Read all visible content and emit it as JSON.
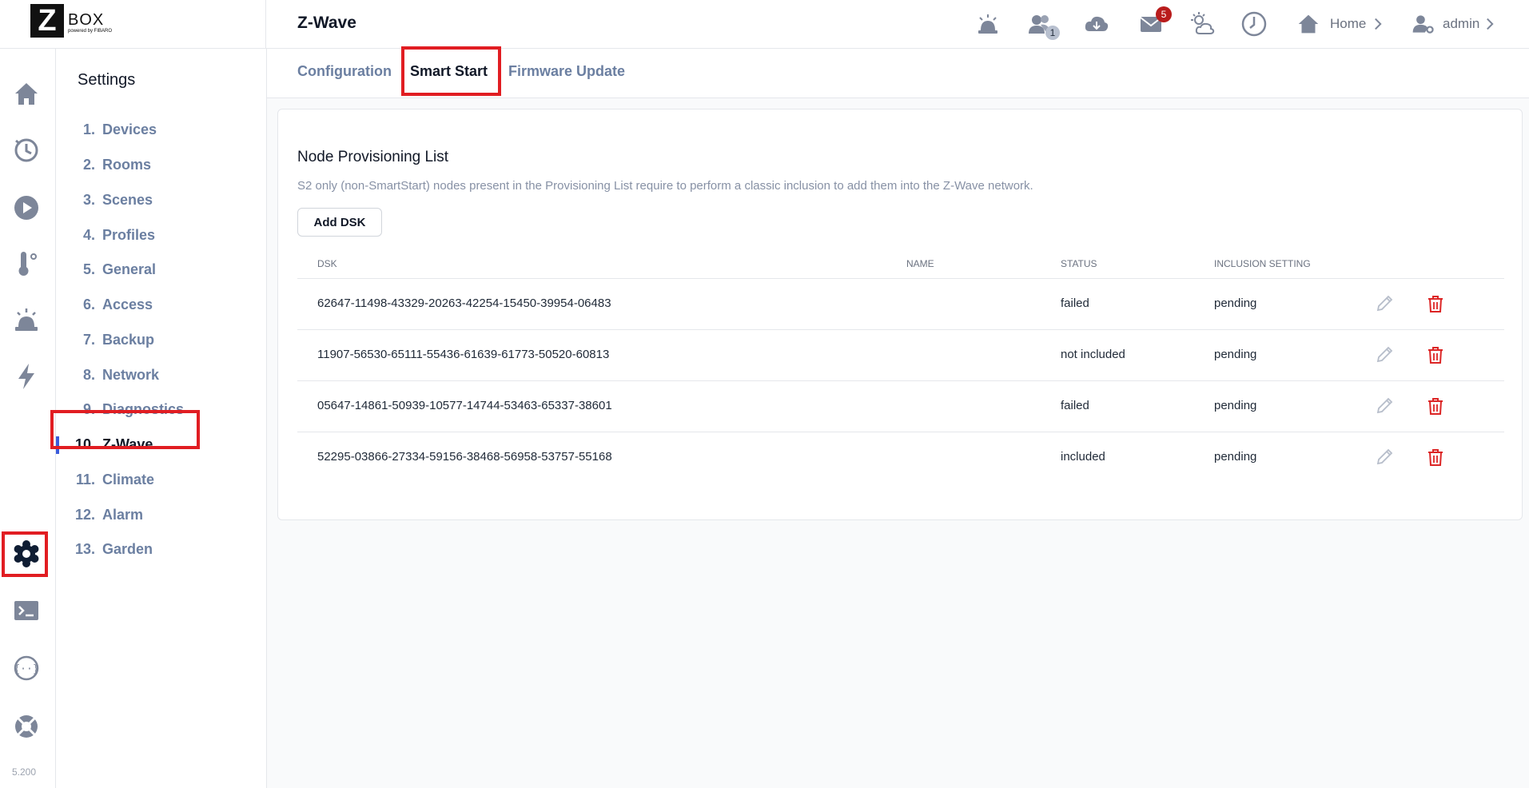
{
  "brand": {
    "logo_letter": "Z",
    "logo_word": "BOX",
    "logo_sub": "powered by FIBARO"
  },
  "header": {
    "title": "Z-Wave",
    "users_badge": "1",
    "messages_badge": "5",
    "home_label": "Home",
    "user_label": "admin"
  },
  "rail": {
    "version": "5.200"
  },
  "settings_menu": {
    "title": "Settings",
    "items": [
      {
        "num": "1.",
        "label": "Devices"
      },
      {
        "num": "2.",
        "label": "Rooms"
      },
      {
        "num": "3.",
        "label": "Scenes"
      },
      {
        "num": "4.",
        "label": "Profiles"
      },
      {
        "num": "5.",
        "label": "General"
      },
      {
        "num": "6.",
        "label": "Access"
      },
      {
        "num": "7.",
        "label": "Backup"
      },
      {
        "num": "8.",
        "label": "Network"
      },
      {
        "num": "9.",
        "label": "Diagnostics"
      },
      {
        "num": "10.",
        "label": "Z-Wave"
      },
      {
        "num": "11.",
        "label": "Climate"
      },
      {
        "num": "12.",
        "label": "Alarm"
      },
      {
        "num": "13.",
        "label": "Garden"
      }
    ],
    "active_index": 9
  },
  "tabs": [
    {
      "label": "Configuration"
    },
    {
      "label": "Smart Start"
    },
    {
      "label": "Firmware Update"
    }
  ],
  "provisioning": {
    "title": "Node Provisioning List",
    "description": "S2 only (non-SmartStart) nodes present in the Provisioning List require to perform a classic inclusion to add them into the Z-Wave network.",
    "add_button": "Add DSK",
    "columns": {
      "dsk": "DSK",
      "name": "NAME",
      "status": "STATUS",
      "inclusion": "INCLUSION SETTING"
    },
    "rows": [
      {
        "dsk": "62647-11498-43329-20263-42254-15450-39954-06483",
        "name": "",
        "status": "failed",
        "inclusion": "pending"
      },
      {
        "dsk": "11907-56530-65111-55436-61639-61773-50520-60813",
        "name": "",
        "status": "not included",
        "inclusion": "pending"
      },
      {
        "dsk": "05647-14861-50939-10577-14744-53463-65337-38601",
        "name": "",
        "status": "failed",
        "inclusion": "pending"
      },
      {
        "dsk": "52295-03866-27334-59156-38468-56958-53757-55168",
        "name": "",
        "status": "included",
        "inclusion": "pending"
      }
    ]
  },
  "colors": {
    "highlight": "#e11d22",
    "delete": "#dc2626",
    "icon": "#7d8699",
    "accent": "#3b5bdb"
  }
}
